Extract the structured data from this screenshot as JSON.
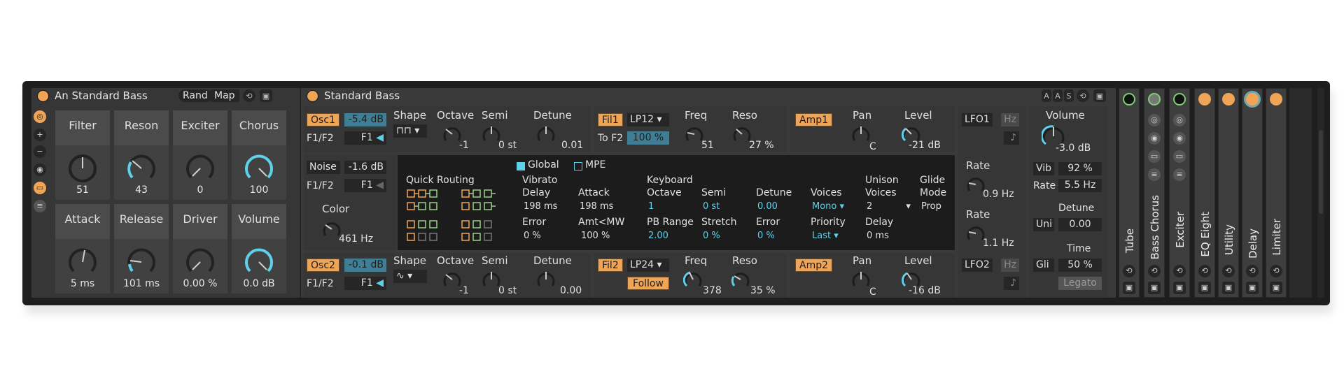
{
  "rack": {
    "title": "An Standard Bass",
    "rand_label": "Rand",
    "map_label": "Map",
    "macros": [
      {
        "label": "Filter",
        "value": "51"
      },
      {
        "label": "Reson",
        "value": "43"
      },
      {
        "label": "Exciter",
        "value": "0"
      },
      {
        "label": "Chorus",
        "value": "100"
      },
      {
        "label": "Attack",
        "value": "5 ms"
      },
      {
        "label": "Release",
        "value": "101 ms"
      },
      {
        "label": "Driver",
        "value": "0.00 %"
      },
      {
        "label": "Volume",
        "value": "0.0 dB"
      }
    ],
    "side_icons": [
      "cycle-icon",
      "plus-icon",
      "minus-icon",
      "camera-icon",
      "device-list-icon",
      "chain-list-icon"
    ]
  },
  "synth": {
    "title": "Standard Bass",
    "header_icons": [
      "A",
      "A",
      "S"
    ],
    "osc1": {
      "label": "Osc1",
      "level": "-5.4 dB",
      "f1f2_label": "F1/F2",
      "f1f2_value": "F1"
    },
    "osc2": {
      "label": "Osc2",
      "level": "-0.1 dB",
      "f1f2_label": "F1/F2",
      "f1f2_value": "F1"
    },
    "noise": {
      "label": "Noise",
      "level": "-1.6 dB",
      "f1f2_label": "F1/F2",
      "f1f2_value": "F1",
      "color_label": "Color",
      "color_value": "461 Hz"
    },
    "osc1_params": {
      "shape_label": "Shape",
      "octave_label": "Octave",
      "octave_value": "-1",
      "semi_label": "Semi",
      "semi_value": "0 st",
      "detune_label": "Detune",
      "detune_value": "0.01"
    },
    "osc2_params": {
      "shape_label": "Shape",
      "octave_label": "Octave",
      "octave_value": "-1",
      "semi_label": "Semi",
      "semi_value": "0 st",
      "detune_label": "Detune",
      "detune_value": "0.00"
    },
    "fil1": {
      "label": "Fil1",
      "type": "LP12",
      "to_f2_label": "To F2",
      "to_f2_value": "100 %",
      "freq_label": "Freq",
      "freq_value": "51",
      "reso_label": "Reso",
      "reso_value": "27 %"
    },
    "fil2": {
      "label": "Fil2",
      "type": "LP24",
      "follow_label": "Follow",
      "freq_label": "Freq",
      "freq_value": "378",
      "reso_label": "Reso",
      "reso_value": "35 %"
    },
    "amp1": {
      "label": "Amp1",
      "pan_label": "Pan",
      "pan_value": "C",
      "level_label": "Level",
      "level_value": "-21 dB"
    },
    "amp2": {
      "label": "Amp2",
      "pan_label": "Pan",
      "pan_value": "C",
      "level_label": "Level",
      "level_value": "-16 dB"
    },
    "lfo1": {
      "label": "LFO1",
      "hz_label": "Hz",
      "rate_label": "Rate",
      "rate_value": "0.9 Hz"
    },
    "lfo2": {
      "label": "LFO2",
      "hz_label": "Hz",
      "rate_label": "Rate",
      "rate_value": "1.1 Hz"
    },
    "global": {
      "global_label": "Global",
      "mpe_label": "MPE",
      "quick_routing_label": "Quick Routing",
      "vibrato_label": "Vibrato",
      "keyboard_label": "Keyboard",
      "delay_label": "Delay",
      "delay_value": "198 ms",
      "attack_label": "Attack",
      "attack_value": "198 ms",
      "error_label": "Error",
      "error_value": "0 %",
      "amt_mw_label": "Amt<MW",
      "amt_mw_value": "100 %",
      "octave_label": "Octave",
      "octave_value": "1",
      "semi_label": "Semi",
      "semi_value": "0 st",
      "detune_label": "Detune",
      "detune_value": "0.00",
      "pb_range_label": "PB Range",
      "pb_range_value": "2.00",
      "stretch_label": "Stretch",
      "stretch_value": "0 %",
      "kb_error_label": "Error",
      "kb_error_value": "0 %",
      "voices_label": "Voices",
      "voices_value": "Mono",
      "priority_label": "Priority",
      "priority_value": "Last",
      "unison_label": "Unison",
      "unison_voices_label": "Voices",
      "unison_voices_value": "2",
      "unison_delay_label": "Delay",
      "unison_delay_value": "0 ms",
      "glide_label": "Glide",
      "glide_mode_label": "Mode",
      "glide_mode_value": "Prop"
    },
    "volume": {
      "label": "Volume",
      "value": "-3.0 dB",
      "vib_label": "Vib",
      "vib_value": "92 %",
      "rate_label": "Rate",
      "rate_value": "5.5 Hz",
      "detune_label": "Detune",
      "uni_label": "Uni",
      "detune_value": "0.00",
      "time_label": "Time",
      "gli_label": "Gli",
      "time_value": "50 %",
      "legato_label": "Legato"
    }
  },
  "fx_chain": [
    {
      "name": "Tube"
    },
    {
      "name": "Bass Chorus"
    },
    {
      "name": "Exciter"
    },
    {
      "name": "EQ Eight"
    },
    {
      "name": "Utility"
    },
    {
      "name": "Delay"
    },
    {
      "name": "Limiter"
    }
  ],
  "colors": {
    "accent_orange": "#f0a455",
    "accent_cyan": "#5fd0ea",
    "panel": "#363636",
    "background": "#1e1e1e"
  }
}
